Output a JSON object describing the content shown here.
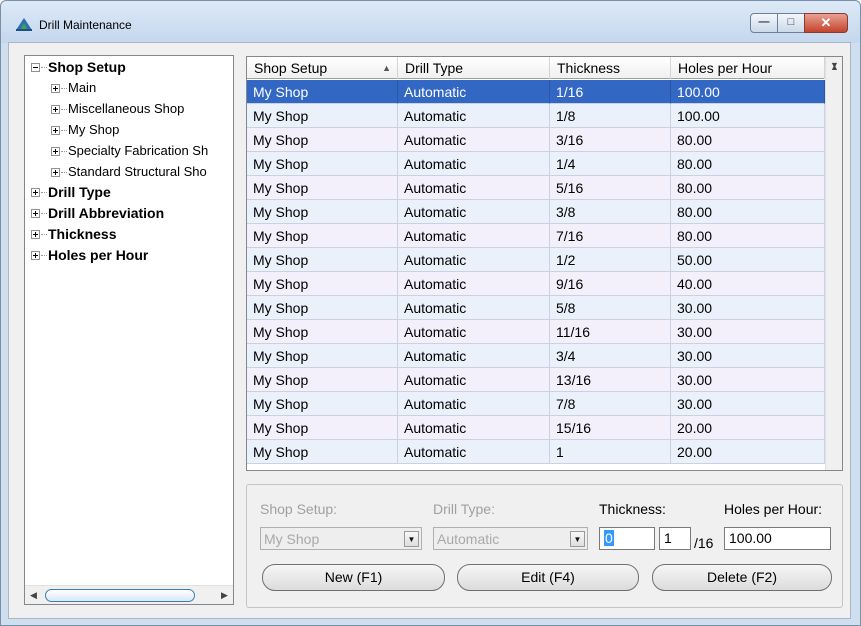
{
  "window": {
    "title": "Drill Maintenance"
  },
  "tree": {
    "nodes": [
      {
        "label": "Shop Setup",
        "level": 0,
        "bold": true,
        "expanded": true
      },
      {
        "label": "Main",
        "level": 1,
        "bold": false,
        "expanded": false
      },
      {
        "label": "Miscellaneous Shop",
        "level": 1,
        "bold": false,
        "expanded": false
      },
      {
        "label": "My Shop",
        "level": 1,
        "bold": false,
        "expanded": false
      },
      {
        "label": "Specialty Fabrication Sh",
        "level": 1,
        "bold": false,
        "expanded": false
      },
      {
        "label": "Standard Structural Sho",
        "level": 1,
        "bold": false,
        "expanded": false
      },
      {
        "label": "Drill Type",
        "level": 0,
        "bold": true,
        "expanded": false
      },
      {
        "label": "Drill Abbreviation",
        "level": 0,
        "bold": true,
        "expanded": false
      },
      {
        "label": "Thickness",
        "level": 0,
        "bold": true,
        "expanded": false
      },
      {
        "label": "Holes per Hour",
        "level": 0,
        "bold": true,
        "expanded": false
      }
    ]
  },
  "grid": {
    "columns": [
      "Shop Setup",
      "Drill Type",
      "Thickness",
      "Holes per Hour"
    ],
    "sorted_column": "Shop Setup",
    "rows": [
      [
        "My Shop",
        "Automatic",
        "1/16",
        "100.00"
      ],
      [
        "My Shop",
        "Automatic",
        "1/8",
        "100.00"
      ],
      [
        "My Shop",
        "Automatic",
        "3/16",
        "80.00"
      ],
      [
        "My Shop",
        "Automatic",
        "1/4",
        "80.00"
      ],
      [
        "My Shop",
        "Automatic",
        "5/16",
        "80.00"
      ],
      [
        "My Shop",
        "Automatic",
        "3/8",
        "80.00"
      ],
      [
        "My Shop",
        "Automatic",
        "7/16",
        "80.00"
      ],
      [
        "My Shop",
        "Automatic",
        "1/2",
        "50.00"
      ],
      [
        "My Shop",
        "Automatic",
        "9/16",
        "40.00"
      ],
      [
        "My Shop",
        "Automatic",
        "5/8",
        "30.00"
      ],
      [
        "My Shop",
        "Automatic",
        "11/16",
        "30.00"
      ],
      [
        "My Shop",
        "Automatic",
        "3/4",
        "30.00"
      ],
      [
        "My Shop",
        "Automatic",
        "13/16",
        "30.00"
      ],
      [
        "My Shop",
        "Automatic",
        "7/8",
        "30.00"
      ],
      [
        "My Shop",
        "Automatic",
        "15/16",
        "20.00"
      ],
      [
        "My Shop",
        "Automatic",
        "1",
        "20.00"
      ]
    ],
    "selected_row": 0
  },
  "editor": {
    "shop_setup_label": "Shop Setup:",
    "shop_setup_value": "My Shop",
    "drill_type_label": "Drill Type:",
    "drill_type_value": "Automatic",
    "thickness_label": "Thickness:",
    "thickness_whole": "0",
    "thickness_numerator": "1",
    "thickness_denominator": "/16",
    "holes_per_hour_label": "Holes per Hour:",
    "holes_per_hour_value": "100.00"
  },
  "buttons": {
    "new_label": "New (F1)",
    "edit_label": "Edit (F4)",
    "delete_label": "Delete (F2)"
  },
  "colors": {
    "selection": "#3367c4",
    "row_alt_a": "#f3f0fb",
    "row_alt_b": "#eaf1fb",
    "title_bar": "#c4d7ee"
  }
}
